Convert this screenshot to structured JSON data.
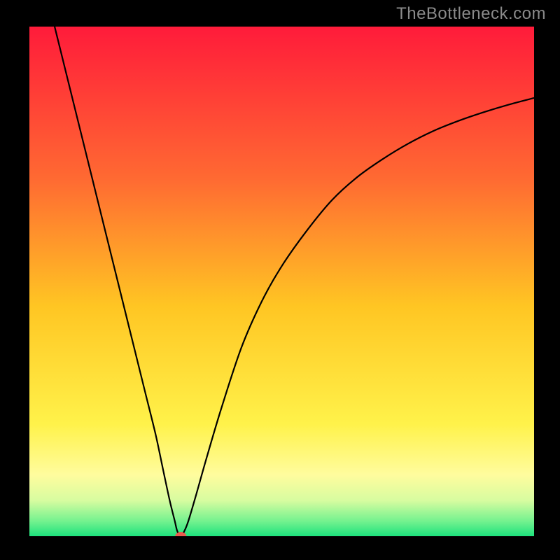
{
  "watermark": "TheBottleneck.com",
  "chart_data": {
    "type": "line",
    "title": "",
    "xlabel": "",
    "ylabel": "",
    "xlim": [
      0,
      100
    ],
    "ylim": [
      0,
      100
    ],
    "background_gradient": {
      "orientation": "vertical",
      "stops": [
        {
          "offset": 0,
          "color": "#ff1b3a"
        },
        {
          "offset": 0.3,
          "color": "#ff6a32"
        },
        {
          "offset": 0.55,
          "color": "#ffc623"
        },
        {
          "offset": 0.78,
          "color": "#fff24a"
        },
        {
          "offset": 0.88,
          "color": "#fffc9e"
        },
        {
          "offset": 0.93,
          "color": "#d7fca0"
        },
        {
          "offset": 0.97,
          "color": "#75f28f"
        },
        {
          "offset": 1.0,
          "color": "#1de27d"
        }
      ]
    },
    "series": [
      {
        "name": "bottleneck-curve",
        "color": "#000000",
        "x": [
          5,
          7,
          9,
          11,
          13,
          15,
          17,
          19,
          21,
          23,
          25,
          26.5,
          27.8,
          28.8,
          29.3,
          30.0,
          30.7,
          31.5,
          33,
          35,
          38,
          42,
          46,
          50,
          55,
          60,
          65,
          70,
          75,
          80,
          85,
          90,
          95,
          100
        ],
        "y": [
          100,
          92,
          84,
          76,
          68,
          60,
          52,
          44,
          36,
          28,
          20,
          13,
          7,
          3,
          1,
          0,
          1,
          3,
          8,
          15,
          25,
          37,
          46,
          53,
          60,
          66,
          70.5,
          74,
          77,
          79.5,
          81.5,
          83.2,
          84.7,
          86
        ]
      }
    ],
    "marker": {
      "name": "minimum-marker",
      "x": 30.0,
      "y": 0,
      "color": "#ea5a4e",
      "rx": 8,
      "ry": 6
    },
    "grid": false,
    "legend": false
  }
}
